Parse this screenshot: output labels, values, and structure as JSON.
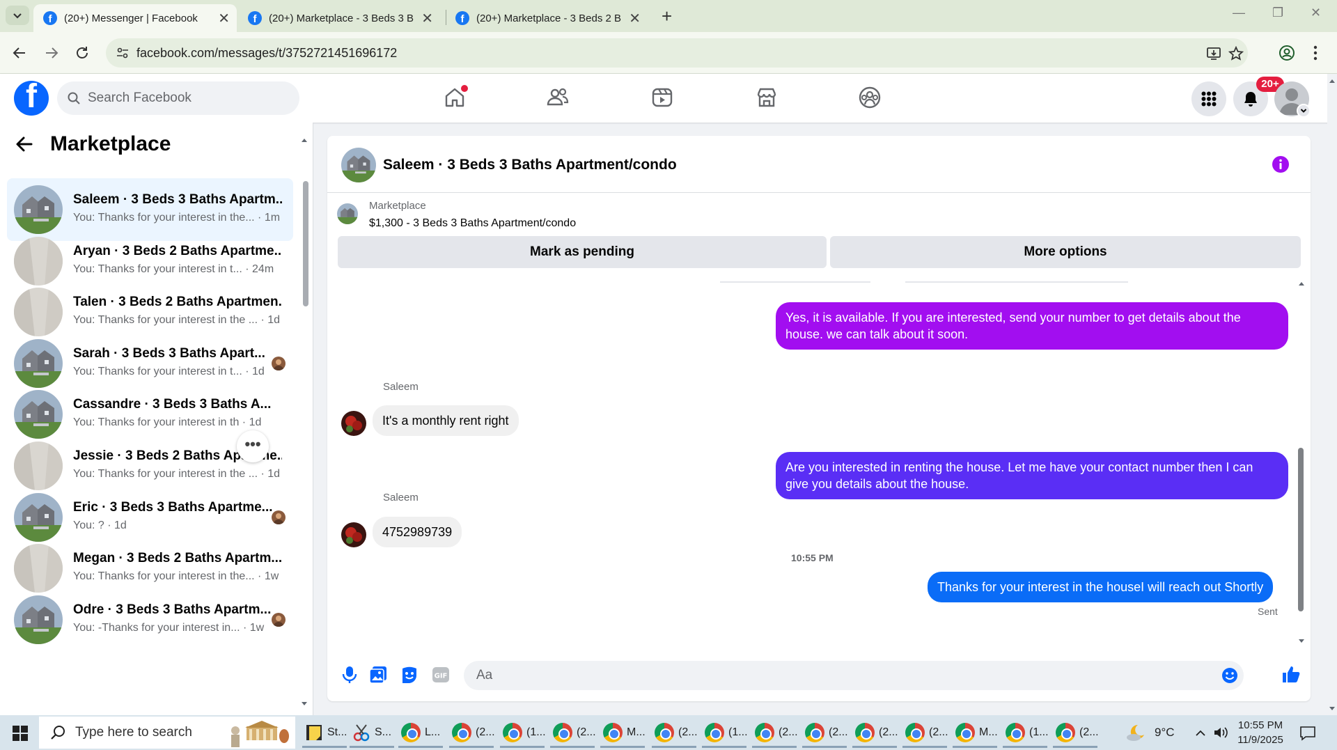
{
  "browser": {
    "tabs": [
      {
        "title": "(20+) Messenger | Facebook",
        "active": true
      },
      {
        "title": "(20+) Marketplace - 3 Beds 3 B",
        "active": false
      },
      {
        "title": "(20+) Marketplace - 3 Beds 2 B",
        "active": false
      }
    ],
    "url": "facebook.com/messages/t/3752721451696172"
  },
  "fb_header": {
    "logo": "f",
    "search_placeholder": "Search Facebook",
    "nav_icons": [
      "home-icon",
      "friends-icon",
      "video-icon",
      "marketplace-icon",
      "groups-icon"
    ],
    "notification_badge": "20+"
  },
  "left_panel": {
    "title": "Marketplace",
    "conversations": [
      {
        "name": "Saleem · 3 Beds 3 Baths Apartm...",
        "preview": "You: Thanks for your interest in the...",
        "time": "1m",
        "image": "house",
        "selected": true,
        "seen": false
      },
      {
        "name": "Aryan · 3 Beds 2 Baths Apartme...",
        "preview": "You: Thanks for your interest in t...",
        "time": "24m",
        "image": "room",
        "selected": false,
        "seen": false
      },
      {
        "name": "Talen · 3 Beds 2 Baths Apartmen...",
        "preview": "You: Thanks for your interest in the ...",
        "time": "1d",
        "image": "room",
        "selected": false,
        "seen": false
      },
      {
        "name": "Sarah · 3 Beds 3 Baths Apart...",
        "preview": "You: Thanks for your interest in t...",
        "time": "1d",
        "image": "house",
        "selected": false,
        "seen": true
      },
      {
        "name": "Cassandre · 3 Beds 3 Baths A...",
        "preview": "You: Thanks for your interest in th",
        "time": "1d",
        "image": "house",
        "selected": false,
        "seen": false
      },
      {
        "name": "Jessie · 3 Beds 2 Baths Apartme...",
        "preview": "You: Thanks for your interest in the ...",
        "time": "1d",
        "image": "room",
        "selected": false,
        "seen": false
      },
      {
        "name": "Eric · 3 Beds 3 Baths Apartme...",
        "preview": "You: ?",
        "time": "1d",
        "image": "house",
        "selected": false,
        "seen": true
      },
      {
        "name": "Megan · 3 Beds 2 Baths Apartm...",
        "preview": "You: Thanks for your interest in the...",
        "time": "1w",
        "image": "room",
        "selected": false,
        "seen": false
      },
      {
        "name": "Odre · 3 Beds 3 Baths Apartm...",
        "preview": "You: -Thanks for your interest in...",
        "time": "1w",
        "image": "house",
        "selected": false,
        "seen": true
      }
    ],
    "more_button": "•••"
  },
  "chat": {
    "title": "Saleem · 3 Beds 3 Baths Apartment/condo",
    "marketplace_label": "Marketplace",
    "listing": "$1,300 - 3 Beds 3 Baths Apartment/condo",
    "buttons": {
      "pending": "Mark as pending",
      "more": "More options"
    },
    "messages": [
      {
        "dir": "out",
        "text": "Yes, it is available. If you are interested, send your number to get details about the house. we can talk about it soon.",
        "color": "#a20ef0"
      },
      {
        "dir": "in",
        "sender": "Saleem",
        "text": "It's a monthly rent right"
      },
      {
        "dir": "out",
        "text": "Are you interested in renting the house.   Let me have your contact number then I can give you details about the house.",
        "color": "#5a2ef5"
      },
      {
        "dir": "in",
        "sender": "Saleem",
        "text": "4752989739"
      },
      {
        "dir": "out",
        "text": "Thanks for your interest in the houseI will reach out Shortly",
        "color": "#0a6cf7"
      }
    ],
    "timestamp": "10:55 PM",
    "status": "Sent",
    "composer_placeholder": "Aa",
    "accent": "#0866ff"
  },
  "taskbar": {
    "search_placeholder": "Type here to search",
    "apps": [
      {
        "label": "St...",
        "icon": "sticky-notes-icon"
      },
      {
        "label": "S...",
        "icon": "snipping-tool-icon"
      },
      {
        "label": "L...",
        "icon": "chrome-icon"
      },
      {
        "label": "(2...",
        "icon": "chrome-icon"
      },
      {
        "label": "(1...",
        "icon": "chrome-icon"
      },
      {
        "label": "(2...",
        "icon": "chrome-icon"
      },
      {
        "label": "M...",
        "icon": "chrome-icon"
      },
      {
        "label": "(2...",
        "icon": "chrome-icon"
      },
      {
        "label": "(1...",
        "icon": "chrome-icon"
      },
      {
        "label": "(2...",
        "icon": "chrome-icon"
      },
      {
        "label": "(2...",
        "icon": "chrome-icon"
      },
      {
        "label": "(2...",
        "icon": "chrome-icon"
      },
      {
        "label": "(2...",
        "icon": "chrome-icon"
      },
      {
        "label": "M...",
        "icon": "chrome-icon"
      },
      {
        "label": "(1...",
        "icon": "chrome-icon"
      },
      {
        "label": "(2...",
        "icon": "chrome-icon"
      }
    ],
    "weather": "9°C",
    "time": "10:55 PM",
    "date": "11/9/2025"
  }
}
